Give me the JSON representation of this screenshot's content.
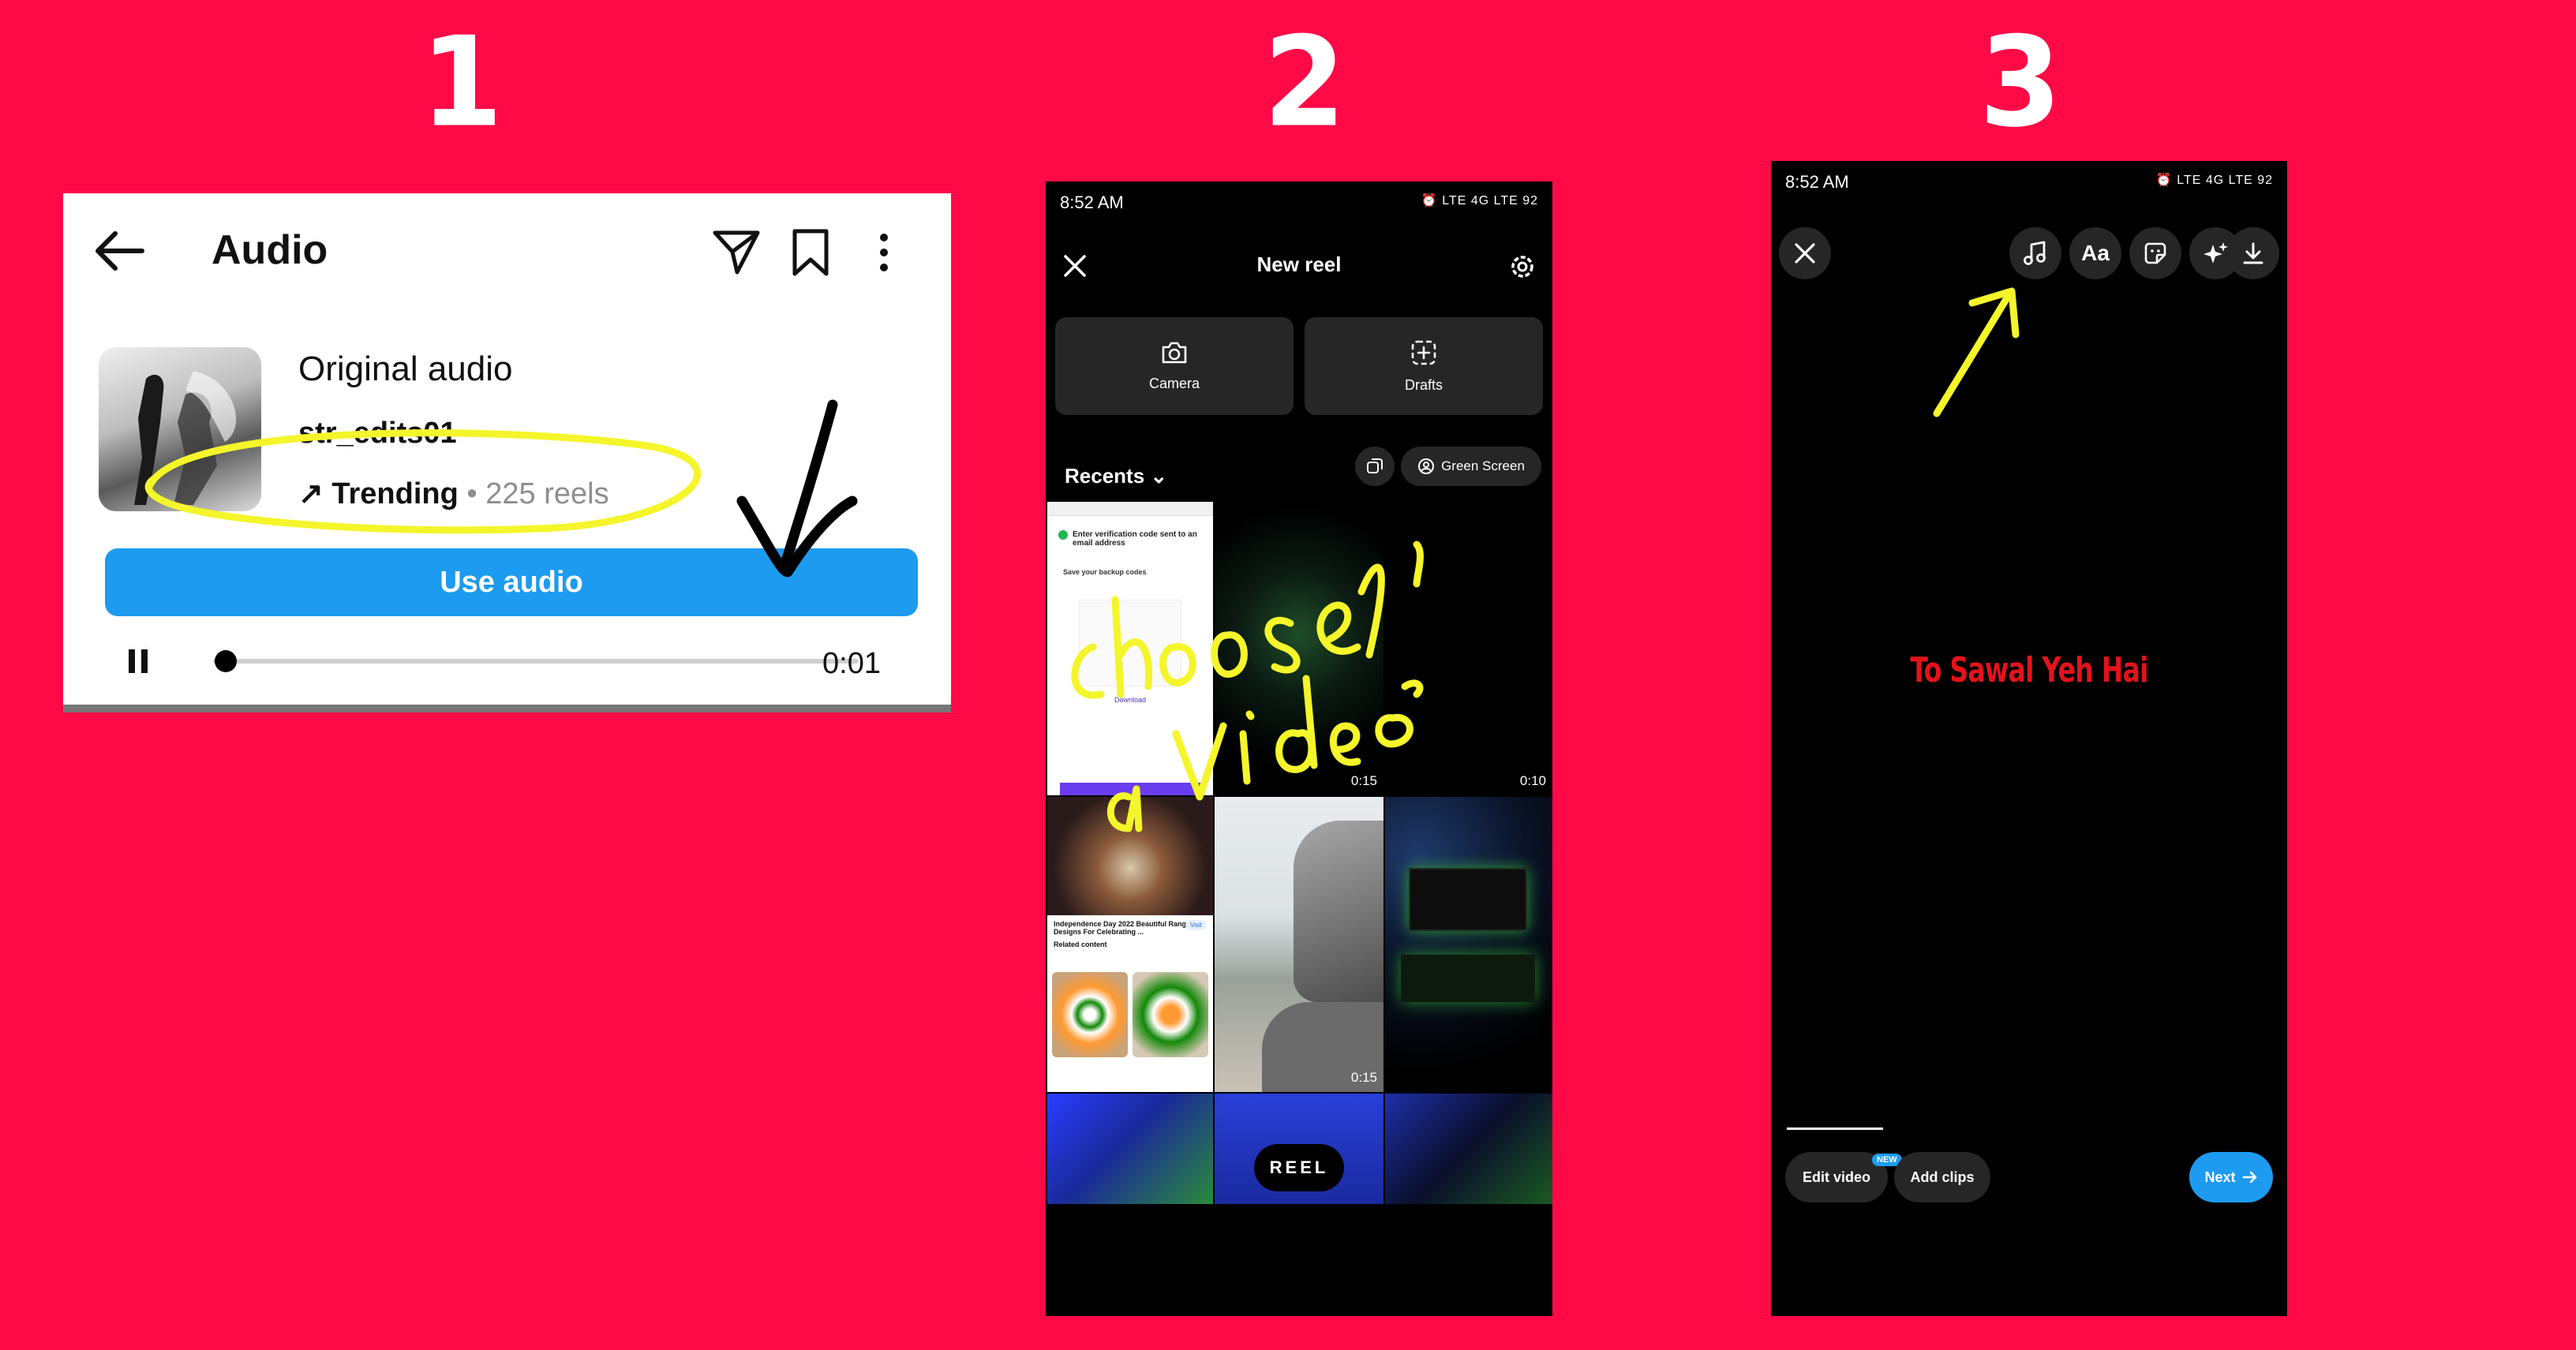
{
  "steps": [
    "1",
    "2",
    "3"
  ],
  "panel1": {
    "title": "Audio",
    "icons": [
      "back-arrow-icon",
      "send-icon",
      "bookmark-icon",
      "more-vertical-icon"
    ],
    "audio_name": "Original audio",
    "username": "str_edits01",
    "trend_label": "↗ Trending",
    "trend_count": " • 225 reels",
    "use_button": "Use audio",
    "time": "0:01",
    "progress": 0.02
  },
  "panel2": {
    "status_time": "8:52 AM",
    "status_right": "⏰ LTE 4G LTE 92",
    "header_title": "New reel",
    "tiles": [
      "Camera",
      "Drafts"
    ],
    "recents_label": "Recents",
    "green_screen": "Green Screen",
    "durations": [
      "0:15",
      "0:10",
      "0:15"
    ],
    "thumb_text": {
      "verify": "Enter verification code sent to an email address",
      "backup": "Save your backup codes",
      "download": "Download",
      "news_title": "Independence Day 2022 Beautiful Rangoli Designs For Celebrating ...",
      "visit": "Visit",
      "related": "Related content"
    },
    "reel_pill": "REEL",
    "annotation": "choose a video"
  },
  "panel3": {
    "status_time": "8:52 AM",
    "status_right": "⏰ LTE 4G LTE 92",
    "toolbar_icons": [
      "close-icon",
      "music-note-icon",
      "text-aa-icon",
      "sticker-icon",
      "effects-sparkle-icon",
      "download-icon"
    ],
    "text_icon_label": "Aa",
    "caption": "To Sawal Yeh Hai",
    "edit_video": "Edit video",
    "new_badge": "NEW",
    "add_clips": "Add clips",
    "next": "Next"
  },
  "colors": {
    "background": "#ff0a47",
    "accent_blue": "#1d9bf0",
    "annotation_yellow": "#f4f52a",
    "caption_red": "#e5121b"
  }
}
